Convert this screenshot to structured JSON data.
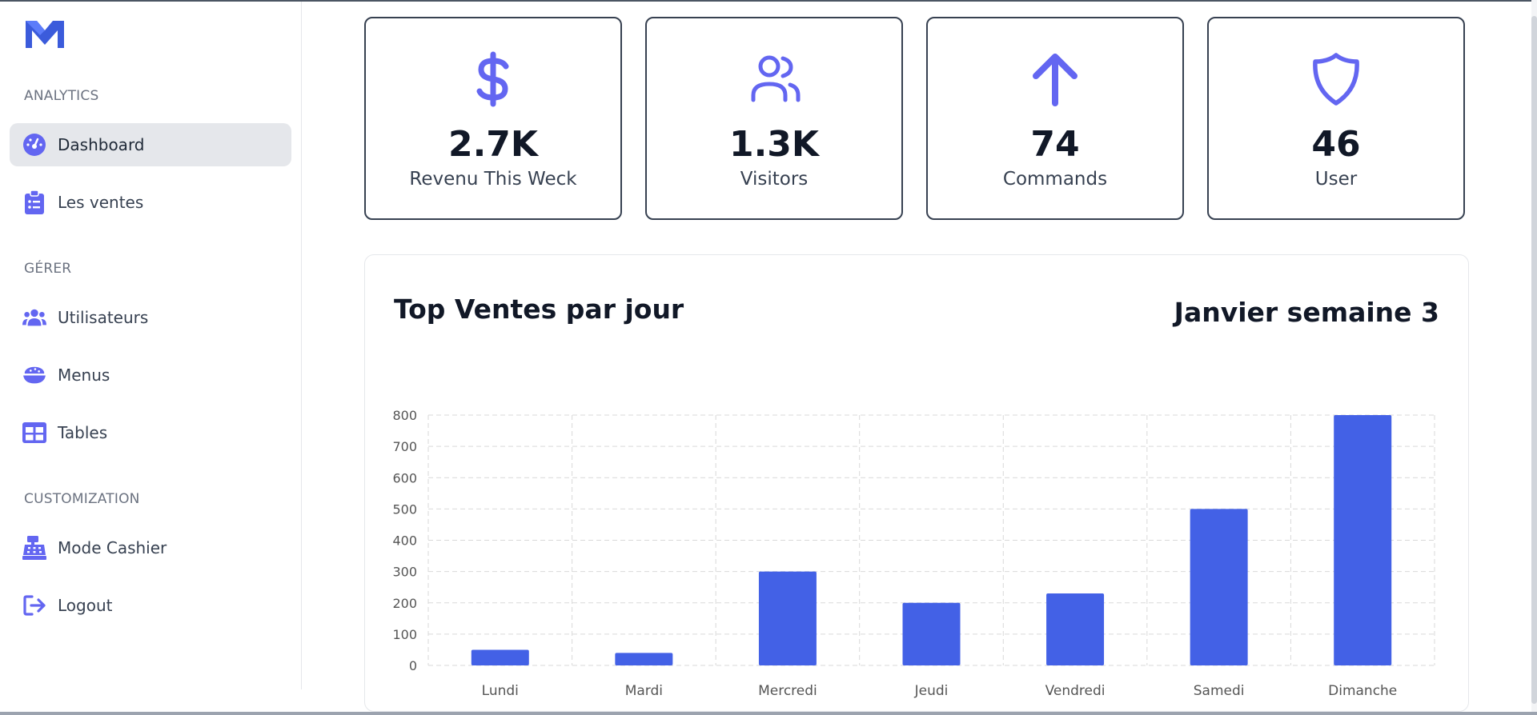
{
  "sidebar": {
    "sections": [
      {
        "title": "ANALYTICS",
        "items": [
          {
            "label": "Dashboard",
            "icon": "dashboard-gauge-icon",
            "active": true
          },
          {
            "label": "Les ventes",
            "icon": "clipboard-list-icon",
            "active": false
          }
        ]
      },
      {
        "title": "GÉRER",
        "items": [
          {
            "label": "Utilisateurs",
            "icon": "users-icon",
            "active": false
          },
          {
            "label": "Menus",
            "icon": "bowl-icon",
            "active": false
          },
          {
            "label": "Tables",
            "icon": "table-grid-icon",
            "active": false
          }
        ]
      },
      {
        "title": "CUSTOMIZATION",
        "items": [
          {
            "label": "Mode Cashier",
            "icon": "cash-register-icon",
            "active": false
          },
          {
            "label": "Logout",
            "icon": "logout-icon",
            "active": false
          }
        ]
      }
    ]
  },
  "stats": [
    {
      "value": "2.7K",
      "label": "Revenu This Weck",
      "icon": "dollar-icon"
    },
    {
      "value": "1.3K",
      "label": "Visitors",
      "icon": "users-outline-icon"
    },
    {
      "value": "74",
      "label": "Commands",
      "icon": "arrow-up-icon"
    },
    {
      "value": "46",
      "label": "User",
      "icon": "shield-icon"
    }
  ],
  "panel": {
    "title": "Top Ventes par jour",
    "period": "Janvier semaine 3"
  },
  "colors": {
    "accent": "#6366f1",
    "bar": "#4361e6",
    "grid": "#d9d9d9"
  },
  "chart_data": {
    "type": "bar",
    "categories": [
      "Lundi",
      "Mardi",
      "Mercredi",
      "Jeudi",
      "Vendredi",
      "Samedi",
      "Dimanche"
    ],
    "values": [
      50,
      40,
      300,
      200,
      230,
      500,
      800
    ],
    "ylim": [
      0,
      800
    ],
    "yticks": [
      0,
      100,
      200,
      300,
      400,
      500,
      600,
      700,
      800
    ],
    "grid": true,
    "legend": "none"
  }
}
